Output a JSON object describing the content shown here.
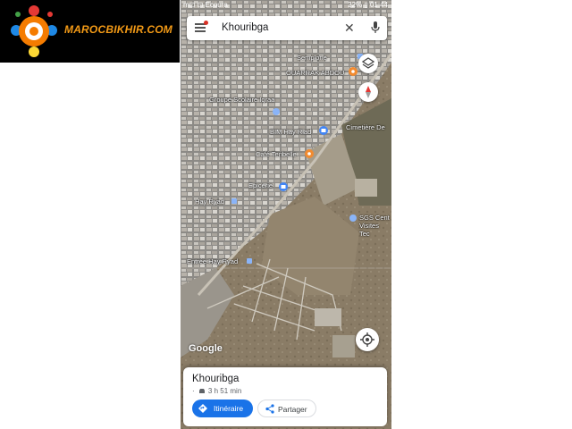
{
  "watermark": {
    "brand": "MAROCBIKHIR.COM"
  },
  "status_bar": {
    "left": "m⊡ ⊡ Ecoura",
    "right": "22% ▯ 01:44"
  },
  "search": {
    "query": "Khouribga"
  },
  "map_labels": [
    "Semplone",
    "OUARRAK ABDOU",
    "Groupe Scolaire Iqraa",
    "BIM Hay Riad",
    "Cimetière De",
    "Café Tenbelle",
    "Epicerie",
    "Hay Ryad",
    "SGS Cent Visites Tec",
    "Entrée Hay Ryad"
  ],
  "map_attribution": "Google",
  "place_card": {
    "name": "Khouribga",
    "eta": "3 h 51 min",
    "directions_label": "Itinéraire",
    "share_label": "Partager"
  },
  "colors": {
    "accent": "#1a73e8",
    "poi_orange": "#f28b30",
    "poi_blue": "#4285f4",
    "compass_red": "#e53935"
  }
}
